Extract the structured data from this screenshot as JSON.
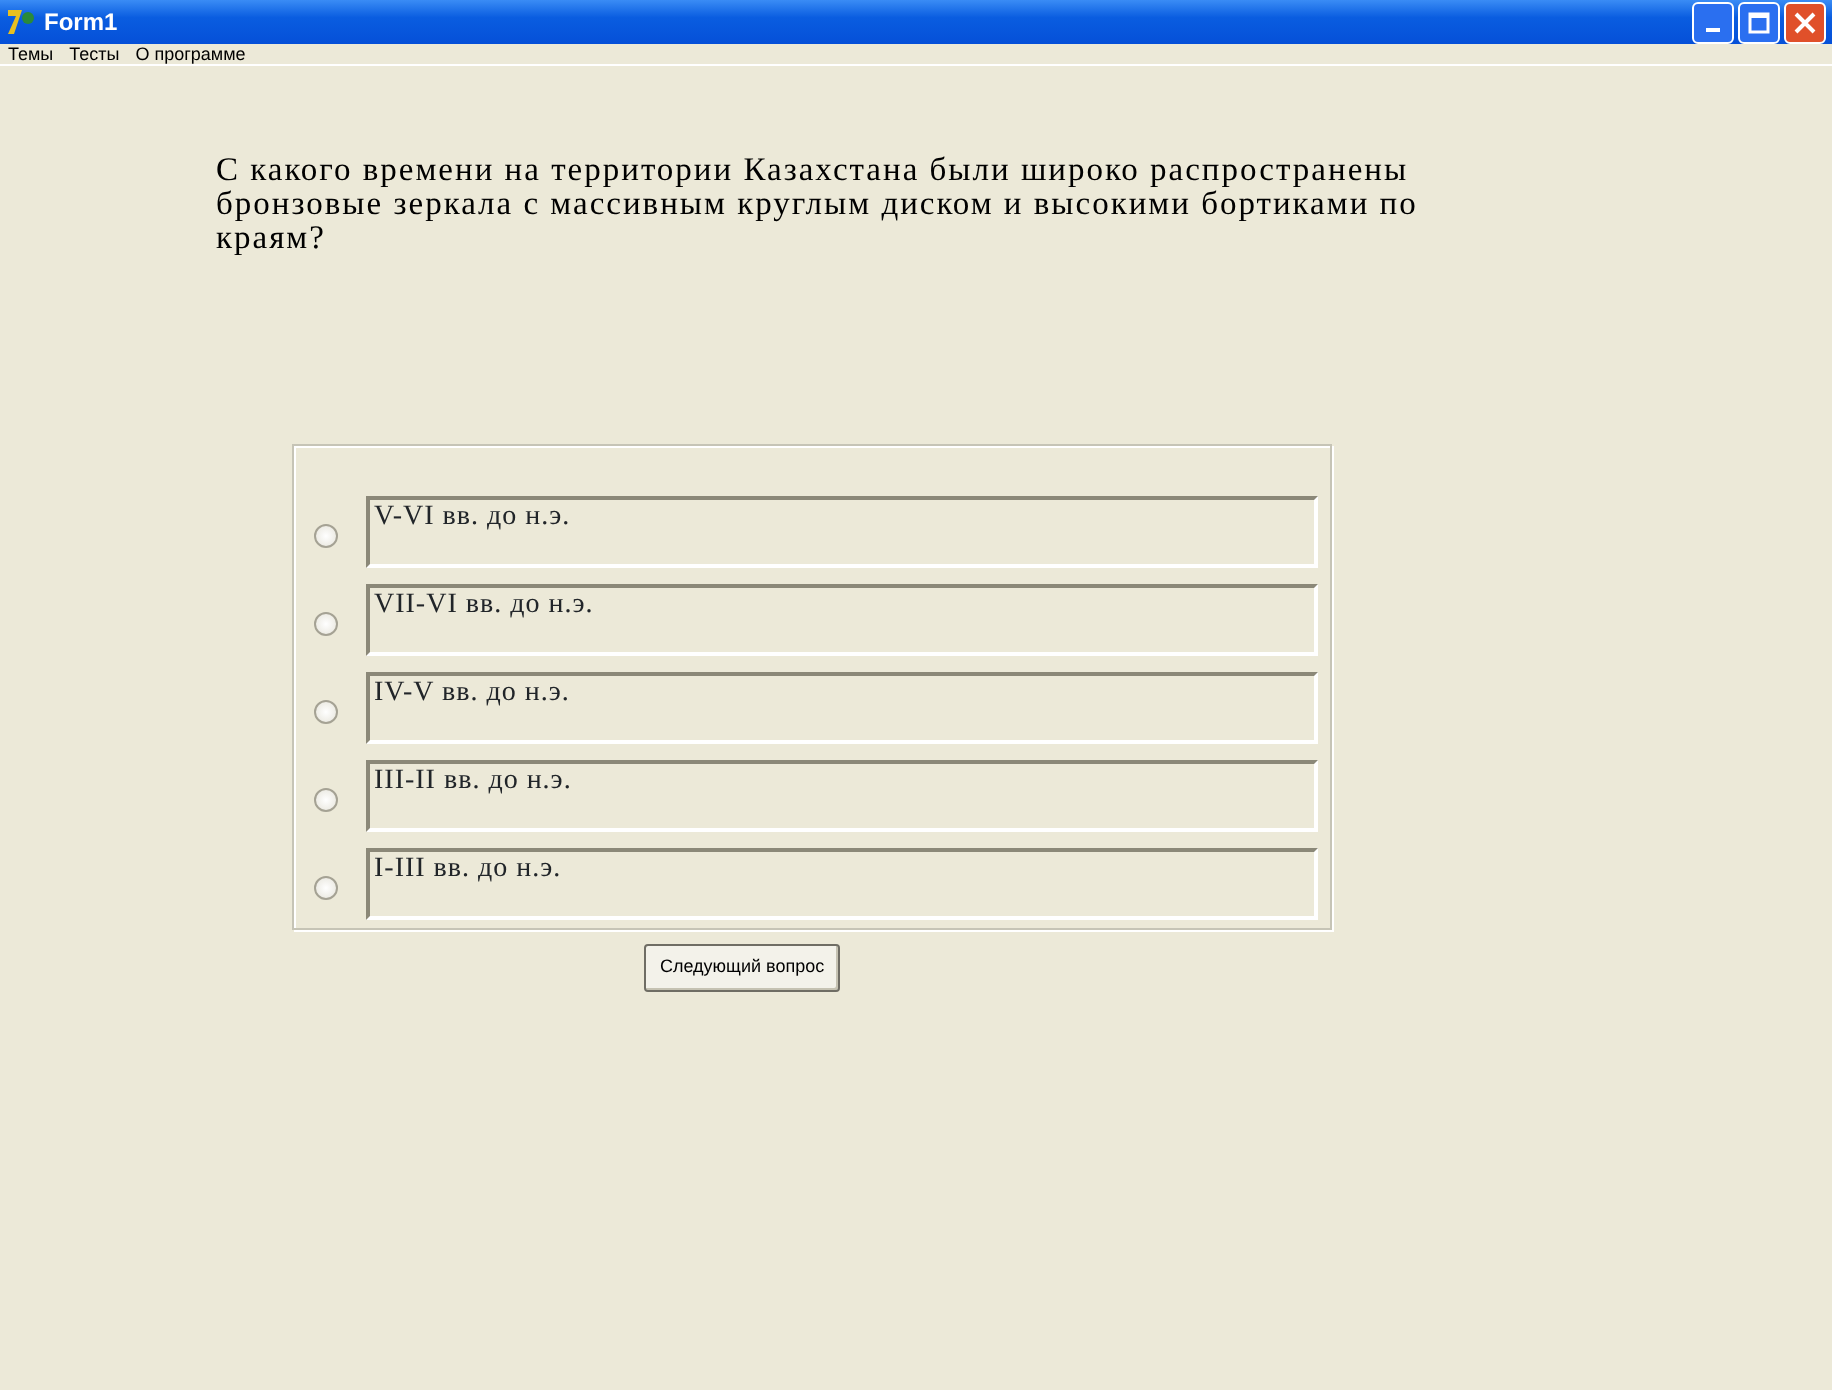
{
  "window": {
    "title": "Form1"
  },
  "menu": [
    "Темы",
    "Тесты",
    "О программе"
  ],
  "question": "С какого времени на территории Казахстана были широко распространены бронзовые зеркала с массивным круглым диском и высокими бортиками по краям?",
  "answers": [
    {
      "label": "V-VI вв. до н.э.",
      "selected": false
    },
    {
      "label": "VII-VI вв. до н.э.",
      "selected": false
    },
    {
      "label": "IV-V вв. до н.э.",
      "selected": false
    },
    {
      "label": "III-II вв. до н.э.",
      "selected": false
    },
    {
      "label": "I-III вв. до н.э.",
      "selected": false
    }
  ],
  "button": "Следующий вопрос"
}
